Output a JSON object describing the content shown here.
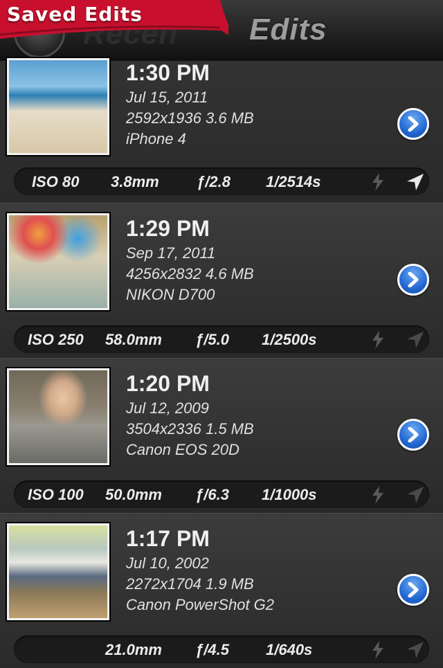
{
  "header": {
    "banner_label": "Saved Edits",
    "brand_partial": "Recen",
    "title": "Edits"
  },
  "colors": {
    "banner_red": "#c8102e",
    "disclosure_blue": "#1f63cf",
    "row_bg": "#2e2e2e"
  },
  "photos": [
    {
      "time": "1:30 PM",
      "date": "Jul 15, 2011",
      "size": "2592x1936 3.6 MB",
      "camera": "iPhone 4",
      "exif": {
        "iso": "ISO 80",
        "focal": "3.8mm",
        "aperture": "ƒ/2.8",
        "shutter": "1/2514s"
      },
      "location_active": true
    },
    {
      "time": "1:29 PM",
      "date": "Sep 17, 2011",
      "size": "4256x2832 4.6 MB",
      "camera": "NIKON D700",
      "exif": {
        "iso": "ISO 250",
        "focal": "58.0mm",
        "aperture": "ƒ/5.0",
        "shutter": "1/2500s"
      },
      "location_active": false
    },
    {
      "time": "1:20 PM",
      "date": "Jul 12, 2009",
      "size": "3504x2336 1.5 MB",
      "camera": "Canon EOS 20D",
      "exif": {
        "iso": "ISO 100",
        "focal": "50.0mm",
        "aperture": "ƒ/6.3",
        "shutter": "1/1000s"
      },
      "location_active": false
    },
    {
      "time": "1:17 PM",
      "date": "Jul 10, 2002",
      "size": "2272x1704 1.9 MB",
      "camera": "Canon PowerShot G2",
      "exif": {
        "iso": "",
        "focal": "21.0mm",
        "aperture": "ƒ/4.5",
        "shutter": "1/640s"
      },
      "location_active": false
    }
  ]
}
